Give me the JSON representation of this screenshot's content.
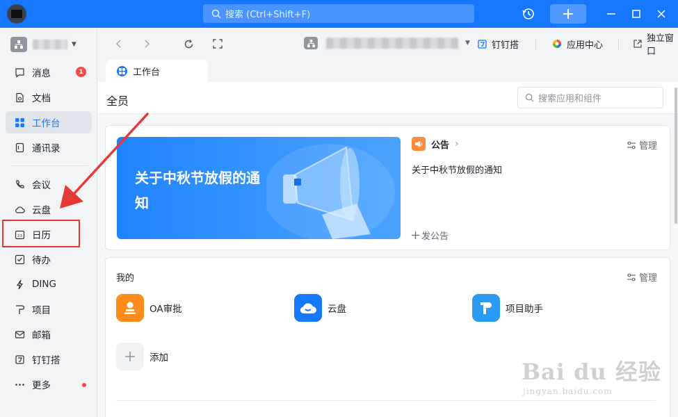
{
  "titlebar": {
    "search_placeholder": "搜索 (Ctrl+Shift+F)",
    "accent": "#1677ff"
  },
  "sidebar": {
    "items": [
      {
        "label": "消息",
        "icon": "message-icon",
        "badge": "1"
      },
      {
        "label": "文档",
        "icon": "document-icon"
      },
      {
        "label": "工作台",
        "icon": "workbench-icon",
        "active": true
      },
      {
        "label": "通讯录",
        "icon": "contacts-icon"
      },
      {
        "label": "会议",
        "icon": "phone-icon"
      },
      {
        "label": "云盘",
        "icon": "cloud-icon"
      },
      {
        "label": "日历",
        "icon": "calendar-icon",
        "highlighted": true
      },
      {
        "label": "待办",
        "icon": "todo-icon"
      },
      {
        "label": "DING",
        "icon": "ding-icon"
      },
      {
        "label": "项目",
        "icon": "project-icon"
      },
      {
        "label": "邮箱",
        "icon": "mail-icon"
      },
      {
        "label": "钉钉搭",
        "icon": "dingda-icon"
      },
      {
        "label": "更多",
        "icon": "more-icon",
        "dot": true
      }
    ]
  },
  "toolbar": {
    "dingda_label": "钉钉搭",
    "app_center_label": "应用中心",
    "standalone_label": "独立窗口"
  },
  "tab": {
    "label": "工作台"
  },
  "content": {
    "title": "全员",
    "search_placeholder": "搜索应用和组件",
    "announcement": {
      "banner_text": "关于中秋节放假的通知",
      "header": "公告",
      "manage_label": "管理",
      "item": "关于中秋节放假的通知",
      "post_label": "发公告"
    },
    "mine": {
      "title": "我的",
      "manage_label": "管理",
      "apps": [
        {
          "label": "OA审批",
          "icon": "oa-approval-icon",
          "color": "#ff8b1a"
        },
        {
          "label": "云盘",
          "icon": "cloud-drive-icon",
          "color": "#1677ff"
        },
        {
          "label": "项目助手",
          "icon": "project-assistant-icon",
          "color": "#2b9af3"
        }
      ],
      "add_label": "添加"
    }
  },
  "watermark": {
    "main": "Bai du 经验",
    "sub": "jingyan.baidu.com"
  }
}
